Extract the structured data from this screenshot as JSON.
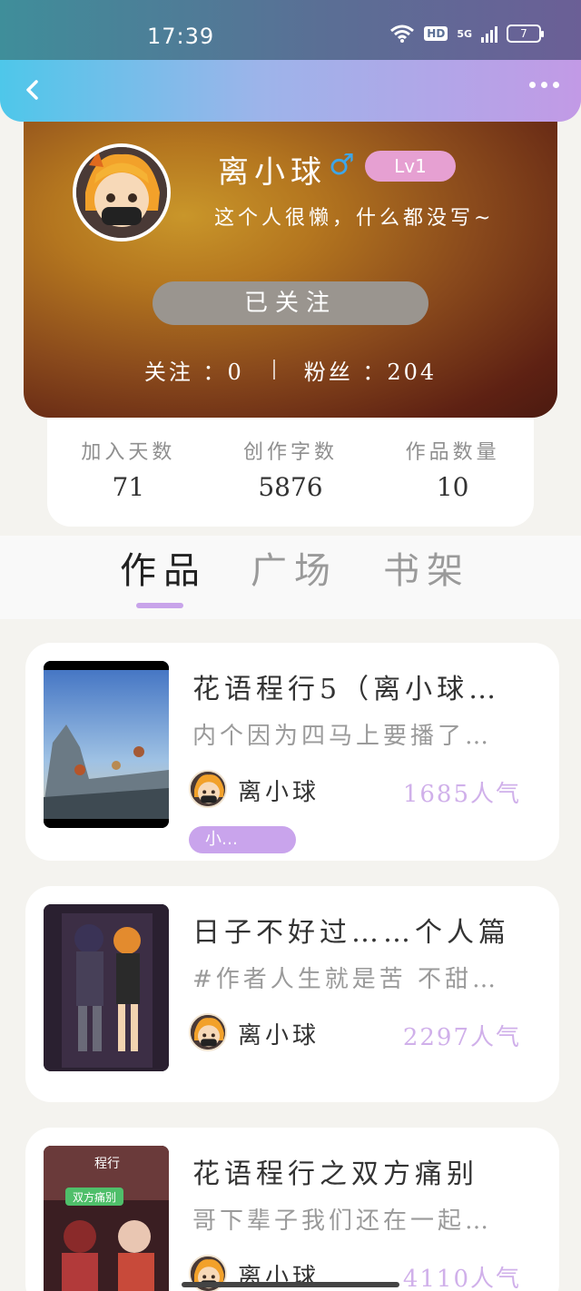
{
  "status": {
    "time": "17:39",
    "hd": "HD",
    "network": "5G",
    "battery": "7"
  },
  "header": {
    "back_icon": "back-arrow-icon",
    "more_icon": "more-dots-icon"
  },
  "profile": {
    "nickname": "离小球",
    "gender_symbol": "♂",
    "level": "Lv1",
    "signature": "这个人很懒，什么都没写~",
    "follow_button": "已关注",
    "following_label": "关注 ：0",
    "followers_label": "粉丝 ：204"
  },
  "info": [
    {
      "label": "加入天数",
      "value": "71"
    },
    {
      "label": "创作字数",
      "value": "5876"
    },
    {
      "label": "作品数量",
      "value": "10"
    }
  ],
  "tabs": [
    {
      "label": "作品",
      "active": true
    },
    {
      "label": "广场",
      "active": false
    },
    {
      "label": "书架",
      "active": false
    }
  ],
  "works": [
    {
      "title": "花语程行5（离小球…",
      "desc": "内个因为四马上要播了…",
      "author": "离小球",
      "popularity": "1685人气",
      "tag": "小…"
    },
    {
      "title": "日子不好过……个人篇",
      "desc": "#作者人生就是苦 不甜…",
      "author": "离小球",
      "popularity": "2297人气",
      "tag": ""
    },
    {
      "title": "花语程行之双方痛别",
      "desc": "哥下辈子我们还在一起…",
      "author": "离小球",
      "popularity": "4110人气",
      "tag": ""
    }
  ],
  "cover3_text": {
    "top": "程行",
    "badge": "双方痛别"
  },
  "colors": {
    "accent_purple": "#c8a4ea",
    "cyan": "#4ec7ea",
    "gender_blue": "#3ea6e8"
  }
}
